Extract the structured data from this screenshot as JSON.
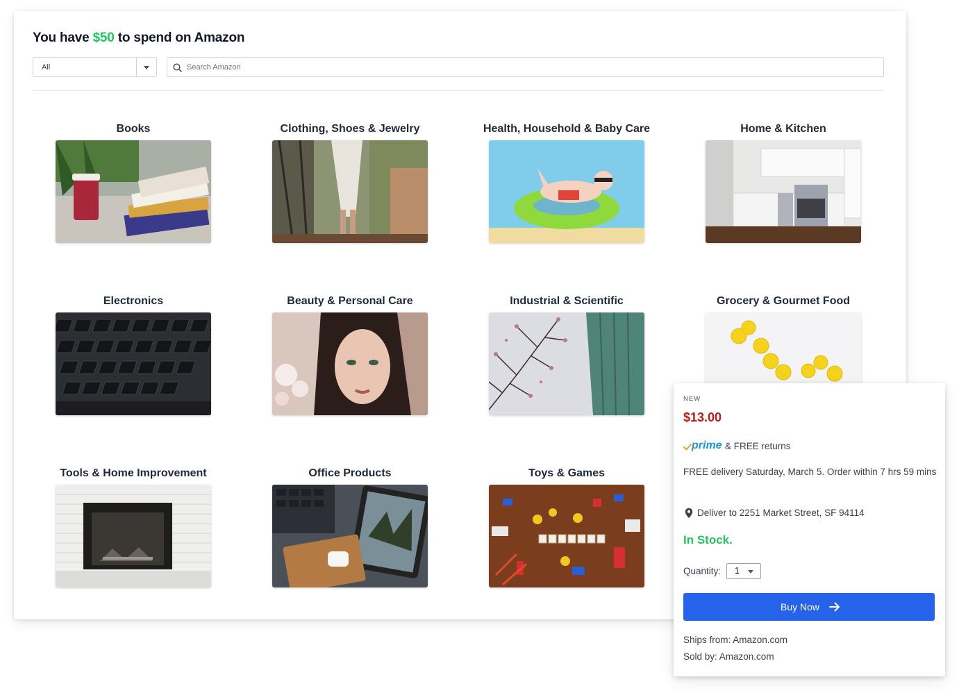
{
  "header": {
    "prefix": "You have",
    "amount": "$50",
    "suffix": "to spend on Amazon",
    "amount_color": "#22c55e"
  },
  "search": {
    "category_value": "All",
    "placeholder": "Search Amazon",
    "icon": "search-icon"
  },
  "categories": [
    {
      "label": "Books"
    },
    {
      "label": "Clothing, Shoes & Jewelry"
    },
    {
      "label": "Health, Household & Baby Care"
    },
    {
      "label": "Home & Kitchen"
    },
    {
      "label": "Electronics"
    },
    {
      "label": "Beauty & Personal Care"
    },
    {
      "label": "Industrial & Scientific"
    },
    {
      "label": "Grocery & Gourmet Food"
    },
    {
      "label": "Tools & Home Improvement"
    },
    {
      "label": "Office Products"
    },
    {
      "label": "Toys & Games"
    }
  ],
  "product": {
    "condition": "NEW",
    "price": "$13.00",
    "price_color": "#b91c1c",
    "prime_logo": "prime",
    "prime_suffix": "& FREE returns",
    "delivery": "FREE delivery Saturday, March 5. Order within 7 hrs 59 mins",
    "address": "Deliver to 2251 Market Street, SF 94114",
    "stock": "In Stock.",
    "stock_color": "#22c55e",
    "quantity_label": "Quantity:",
    "quantity_value": "1",
    "buy_label": "Buy Now",
    "buy_color": "#2563eb",
    "ships_from": "Ships from: Amazon.com",
    "sold_by": "Sold by: Amazon.com"
  }
}
